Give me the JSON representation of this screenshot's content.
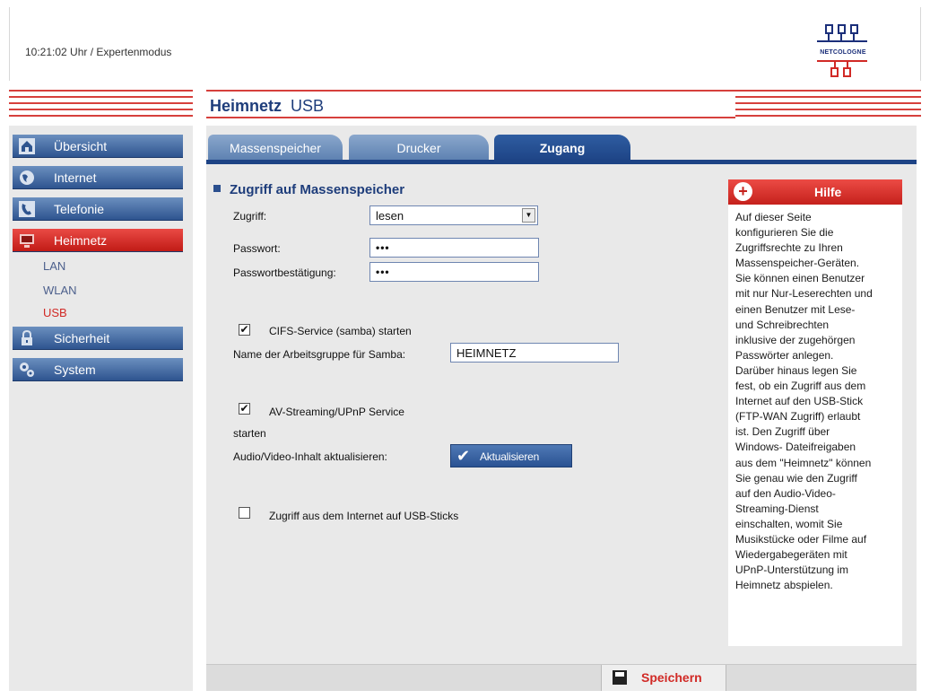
{
  "header": {
    "status_line": "10:21:02 Uhr  / Expertenmodus",
    "logo_text": "NETCOLOGNE"
  },
  "page": {
    "title_bold": "Heimnetz",
    "title_rest": "USB"
  },
  "sidebar": {
    "items": [
      {
        "label": "Übersicht",
        "icon": "home-icon"
      },
      {
        "label": "Internet",
        "icon": "globe-icon"
      },
      {
        "label": "Telefonie",
        "icon": "phone-icon"
      },
      {
        "label": "Heimnetz",
        "icon": "computer-icon",
        "active": true
      },
      {
        "label": "Sicherheit",
        "icon": "lock-icon"
      },
      {
        "label": "System",
        "icon": "gears-icon"
      }
    ],
    "subitems": [
      {
        "label": "LAN"
      },
      {
        "label": "WLAN"
      },
      {
        "label": "USB",
        "active": true
      }
    ]
  },
  "tabs": [
    {
      "label": "Massenspeicher",
      "active": false
    },
    {
      "label": "Drucker",
      "active": false
    },
    {
      "label": "Zugang",
      "active": true
    }
  ],
  "form": {
    "section_title": "Zugriff auf Massenspeicher",
    "zugriff_label": "Zugriff:",
    "zugriff_value": "lesen",
    "passwort_label": "Passwort:",
    "passwort_value": "•••",
    "passwort_confirm_label": "Passwortbestätigung:",
    "passwort_confirm_value": "•••",
    "cifs_label": "CIFS-Service (samba) starten",
    "cifs_checked": true,
    "workgroup_label": "Name der Arbeitsgruppe für Samba:",
    "workgroup_value": "HEIMNETZ",
    "av_label": "AV-Streaming/UPnP Service",
    "av_label_cont": "starten",
    "av_checked": true,
    "refresh_label": "Audio/Video-Inhalt aktualisieren:",
    "refresh_button": "Aktualisieren",
    "internet_access_label": "Zugriff aus dem Internet auf USB-Sticks",
    "internet_access_checked": false
  },
  "help": {
    "title": "Hilfe",
    "lines": [
      "Auf dieser Seite",
      "konfigurieren Sie die",
      "Zugriffsrechte zu Ihren",
      "Massenspeicher-Geräten.",
      "Sie können einen Benutzer",
      "mit nur Nur-Leserechten und",
      "einen Benutzer mit Lese-",
      "und Schreibrechten",
      "inklusive der zugehörgen",
      "Passwörter anlegen.",
      "Darüber hinaus legen Sie",
      "fest, ob ein Zugriff aus dem",
      "Internet auf den USB-Stick",
      "(FTP-WAN Zugriff) erlaubt",
      "ist. Den Zugriff über",
      "Windows- Dateifreigaben",
      "aus dem \"Heimnetz\" können",
      "Sie genau wie den Zugriff",
      "auf den Audio-Video-",
      "Streaming-Dienst",
      "einschalten, womit Sie",
      "Musikstücke oder Filme auf",
      "Wiedergabegeräten mit",
      "UPnP-Unterstützung im",
      "Heimnetz abspielen."
    ]
  },
  "footer": {
    "save_label": "Speichern"
  },
  "colors": {
    "accent_red": "#d12a26",
    "nav_blue": "#2e548f",
    "tab_active": "#1d4385"
  }
}
